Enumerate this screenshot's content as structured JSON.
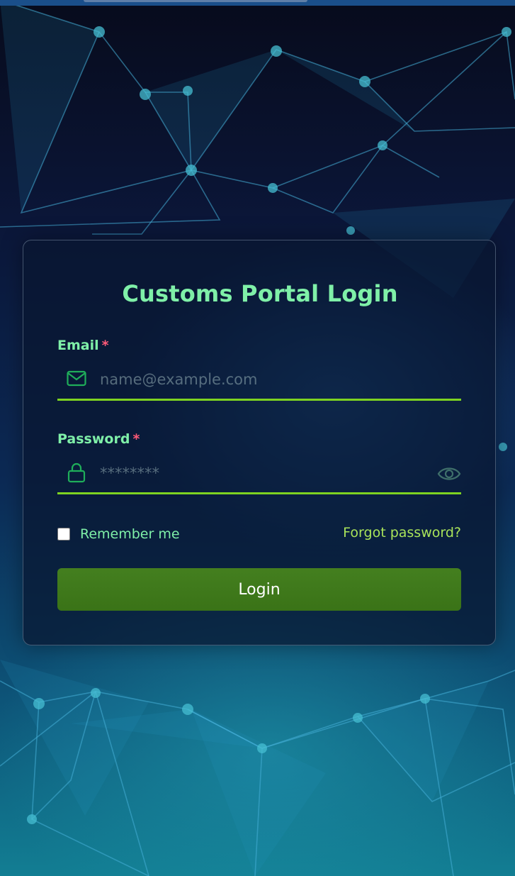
{
  "form": {
    "title": "Customs Portal Login",
    "email": {
      "label": "Email",
      "required_marker": "*",
      "placeholder": "name@example.com",
      "value": "",
      "icon": "envelope-icon"
    },
    "password": {
      "label": "Password",
      "required_marker": "*",
      "placeholder": "********",
      "value": "",
      "icon": "lock-icon",
      "toggle_icon": "eye-icon"
    },
    "remember": {
      "label": "Remember me",
      "checked": false
    },
    "forgot_label": "Forgot password?",
    "submit_label": "Login"
  },
  "colors": {
    "accent": "#7ff0a8",
    "underline": "#7ed321",
    "required": "#ff5a78",
    "link": "#a9e35a",
    "button": "#3f7a1b"
  }
}
